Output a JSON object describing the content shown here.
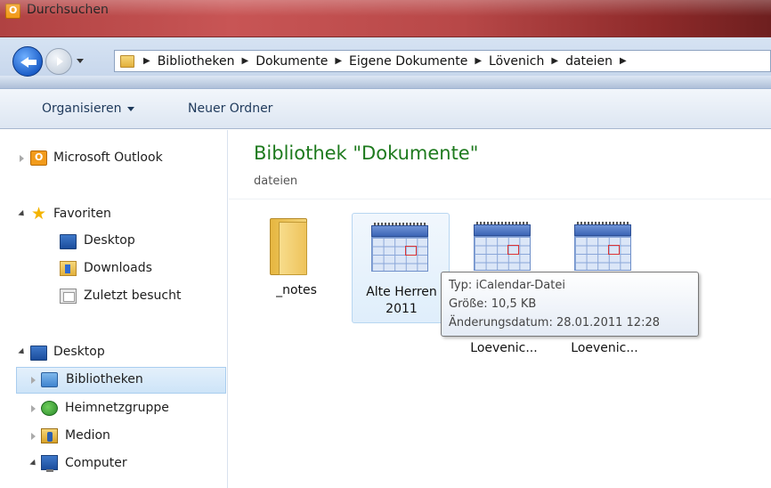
{
  "window": {
    "title": "Durchsuchen"
  },
  "address": {
    "crumbs": [
      "Bibliotheken",
      "Dokumente",
      "Eigene Dokumente",
      "Lövenich",
      "dateien"
    ]
  },
  "toolbar": {
    "organize_label": "Organisieren",
    "new_folder_label": "Neuer Ordner"
  },
  "sidebar": {
    "items": [
      {
        "label": "Microsoft Outlook"
      },
      {
        "label": "Favoriten"
      },
      {
        "label": "Desktop"
      },
      {
        "label": "Downloads"
      },
      {
        "label": "Zuletzt besucht"
      },
      {
        "label": "Desktop"
      },
      {
        "label": "Bibliotheken"
      },
      {
        "label": "Heimnetzgruppe"
      },
      {
        "label": "Medion"
      },
      {
        "label": "Computer"
      }
    ]
  },
  "content": {
    "title": "Bibliothek \"Dokumente\"",
    "subtitle": "dateien",
    "files": [
      {
        "name": "_notes",
        "type": "folder"
      },
      {
        "name_line1": "Alte Herren",
        "name_line2": "2011",
        "type": "calendar"
      },
      {
        "name": "Loevenic...",
        "type": "calendar"
      },
      {
        "name": "Loevenic...",
        "type": "calendar"
      }
    ]
  },
  "tooltip": {
    "type": "Typ: iCalendar-Datei",
    "size": "Größe: 10,5 KB",
    "modified": "Änderungsdatum: 28.01.2011 12:28"
  }
}
